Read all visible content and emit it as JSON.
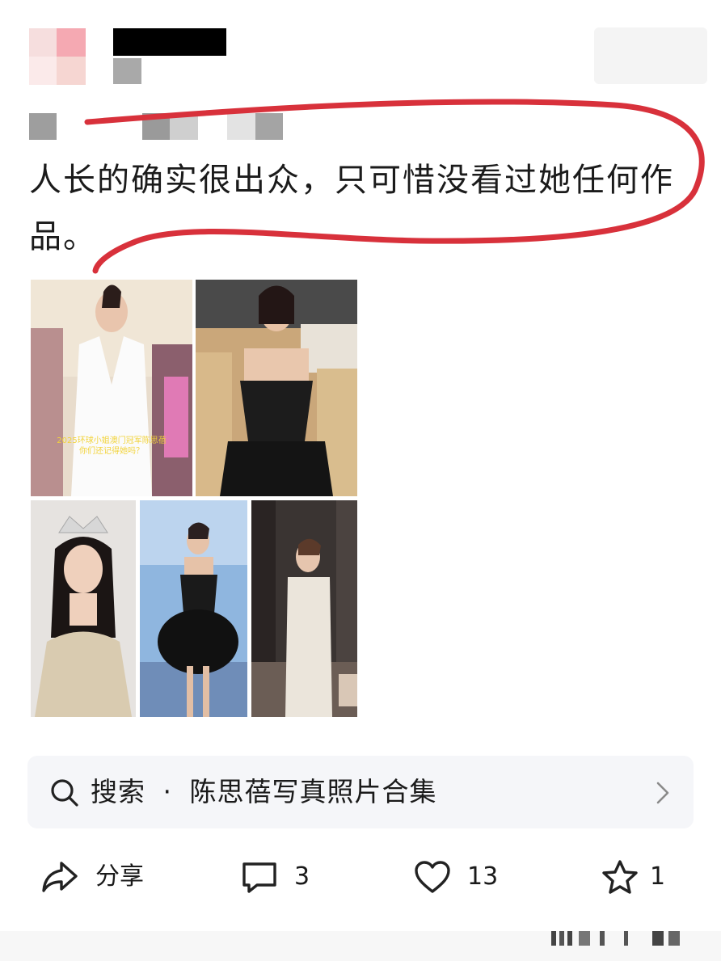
{
  "post": {
    "text": "人长的确实很出众，只可惜没看过她任何作品。",
    "image_overlay_caption": "2025环球小姐澳门冠军陈思蓓\n你们还记得她吗？"
  },
  "search": {
    "prefix": "搜索",
    "separator": "·",
    "query": "陈思蓓写真照片合集"
  },
  "actions": {
    "share_label": "分享",
    "comment_count": "3",
    "like_count": "13",
    "favorite_count": "1"
  },
  "colors": {
    "annotation_red": "#d8313b",
    "search_bg": "#f5f6f9",
    "text": "#1a1a1a"
  },
  "icons": {
    "search": "search-icon",
    "chevron": "chevron-right-icon",
    "share": "share-icon",
    "comment": "comment-icon",
    "like": "heart-icon",
    "favorite": "star-icon"
  }
}
